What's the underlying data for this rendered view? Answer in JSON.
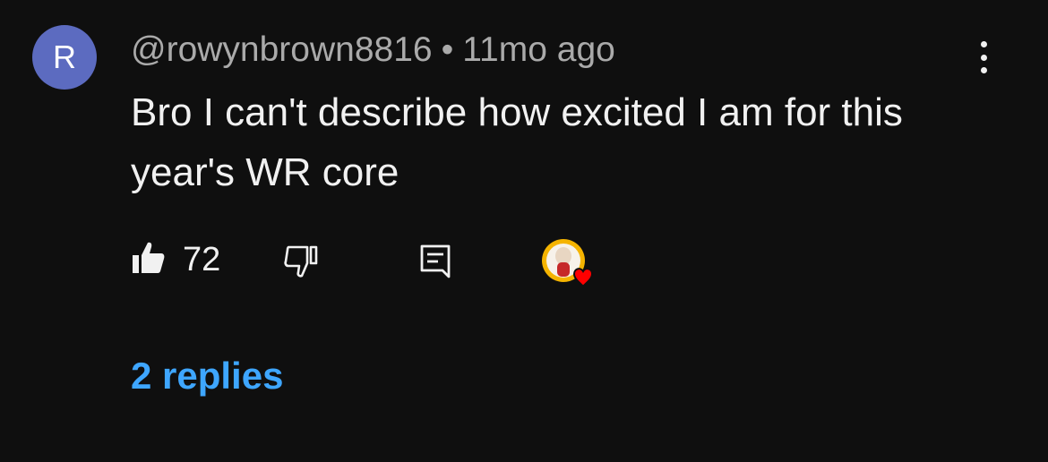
{
  "comment": {
    "avatar_initial": "R",
    "author": "@rowynbrown8816",
    "separator": "•",
    "timestamp": "11mo ago",
    "text": "Bro I can't describe how excited I am for this year's WR core"
  },
  "actions": {
    "like_count": "72",
    "like_icon": "thumbs-up-icon",
    "dislike_icon": "thumbs-down-icon",
    "reply_icon": "comment-icon",
    "creator_heart_icon": "creator-heart-icon"
  },
  "replies": {
    "label": "2 replies"
  },
  "colors": {
    "background": "#0f0f0f",
    "avatar": "#5c6bc0",
    "link": "#3ea6ff",
    "heart": "#ff0000"
  }
}
